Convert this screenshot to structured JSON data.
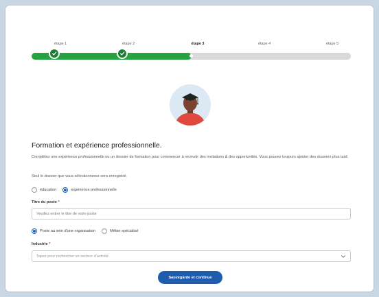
{
  "stepper": {
    "steps": [
      {
        "label": "étape 1",
        "state": "done"
      },
      {
        "label": "étape 2",
        "state": "done"
      },
      {
        "label": "étape 3",
        "state": "active"
      },
      {
        "label": "étape 4",
        "state": "todo"
      },
      {
        "label": "étape 5",
        "state": "todo"
      }
    ],
    "progress_fraction": 0.5,
    "colors": {
      "fill": "#27a243",
      "track": "#d9d9d9",
      "check": "#1a7f33"
    }
  },
  "avatar": {
    "icon": "graduate-avatar-icon"
  },
  "form": {
    "title": "Formation et expérience professionnelle.",
    "description": "Complétez une expérience professionnelle ou un dossier de formation pour commencer à recevoir des invitations & des opportunités. Vous pouvez toujours ajouter des dossiers plus tard.",
    "note": "Seul le dossier que vous sélectionnerez sera enregistré.",
    "record_type": {
      "options": [
        "éducation",
        "expérience professionnelle"
      ],
      "selected": "expérience professionnelle"
    },
    "job_title": {
      "label": "Titre du poste",
      "required_mark": "*",
      "value": "",
      "placeholder": "Veuillez entrer le titre de votre poste"
    },
    "job_type": {
      "options": [
        "Poste au sein d'une organisation",
        "Métier spécialisé"
      ],
      "selected": "Poste au sein d'une organisation"
    },
    "industry": {
      "label": "Industrie",
      "required_mark": "*",
      "placeholder": "Tapez pour rechercher un secteur d'activité",
      "icon": "chevron-down-icon"
    },
    "submit_label": "Sauvegarde et continue",
    "accent": "#1f5cad"
  }
}
